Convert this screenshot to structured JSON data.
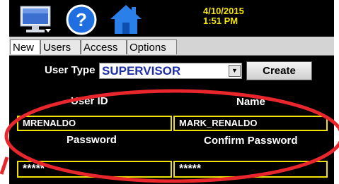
{
  "header": {
    "date": "4/10/2015",
    "time": "1:51 PM",
    "icons": [
      "monitor-icon",
      "help-icon",
      "home-icon"
    ],
    "colors": {
      "datetime": "#f4e400",
      "help_icon": "#1f6fe0",
      "home_icon": "#2a7fe8"
    }
  },
  "tabs": [
    {
      "label": "New",
      "active": true
    },
    {
      "label": "Users",
      "active": false
    },
    {
      "label": "Access",
      "active": false
    },
    {
      "label": "Options",
      "active": false
    }
  ],
  "form": {
    "user_type_label": "User Type",
    "user_type_value": "SUPERVISOR",
    "create_label": "Create",
    "user_id_label": "User ID",
    "name_label": "Name",
    "user_id_value": "MRENALDO",
    "name_value": "MARK_RENALDO",
    "password_label": "Password",
    "confirm_password_label": "Confirm Password",
    "password_value": "*****",
    "confirm_password_value": "*****"
  },
  "annotation": {
    "color": "#e8262b"
  }
}
